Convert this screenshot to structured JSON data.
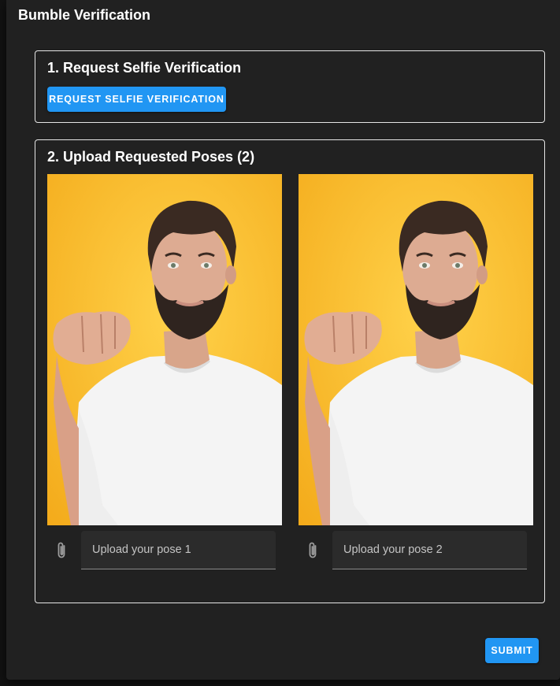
{
  "dialog": {
    "title": "Bumble Verification"
  },
  "step1": {
    "title": "1. Request Selfie Verification",
    "button_label": "REQUEST SELFIE VERIFICATION"
  },
  "step2": {
    "title": "2. Upload Requested Poses (2)",
    "poses": [
      {
        "placeholder": "Upload your pose 1"
      },
      {
        "placeholder": "Upload your pose 2"
      }
    ]
  },
  "footer": {
    "submit_label": "SUBMIT"
  },
  "colors": {
    "accent": "#2196f3",
    "photo_background": "#f6b81f",
    "surface": "#212121"
  },
  "icons": [
    "paperclip-icon"
  ]
}
